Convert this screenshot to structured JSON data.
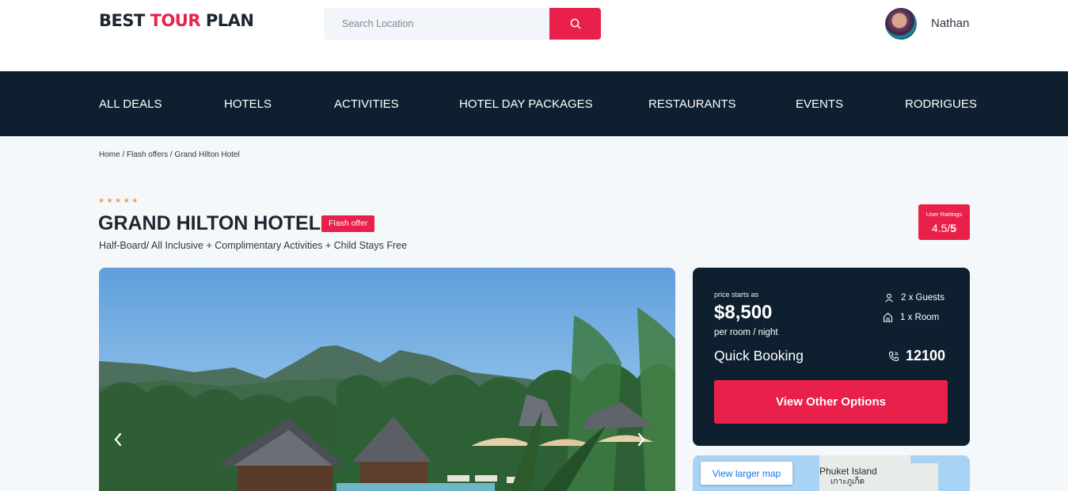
{
  "header": {
    "logo": {
      "part1": "Best",
      "part2": "Tour",
      "part3": "Plan"
    },
    "search": {
      "placeholder": "Search Location",
      "icon": "search-icon"
    },
    "user": {
      "name": "Nathan"
    }
  },
  "nav": {
    "items": [
      {
        "label": "ALL DEALS"
      },
      {
        "label": "HOTELS"
      },
      {
        "label": "ACTIVITIES"
      },
      {
        "label": "HOTEL DAY PACKAGES"
      },
      {
        "label": "RESTAURANTS"
      },
      {
        "label": "EVENTS"
      },
      {
        "label": "RODRIGUES"
      }
    ]
  },
  "breadcrumb": {
    "home": "Home",
    "sep": "/",
    "section": "Flash offers",
    "current": "Grand Hilton Hotel"
  },
  "hotel": {
    "stars": "★★★★★",
    "star_count": 5,
    "name": "GRAND HILTON HOTEL",
    "badge": "Flash offer",
    "subtitle": "Half-Board/ All Inclusive + Complimentary Activities + Child Stays Free",
    "rating_label": "User Rattings",
    "rating_value": "4.5",
    "rating_max": "5"
  },
  "booking": {
    "price_label": "price starts as",
    "price": "$8,500",
    "price_unit": "per room / night",
    "guests": "2 x Guests",
    "rooms": "1 x Room",
    "quick_label": "Quick Booking",
    "phone": "12100",
    "cta": "View Other Options"
  },
  "map": {
    "button": "View larger map",
    "place": "Phuket Island",
    "place_local": "เกาะภูเก็ต"
  },
  "colors": {
    "accent": "#e8204a",
    "dark": "#0e202f",
    "star": "#f29a4a"
  }
}
